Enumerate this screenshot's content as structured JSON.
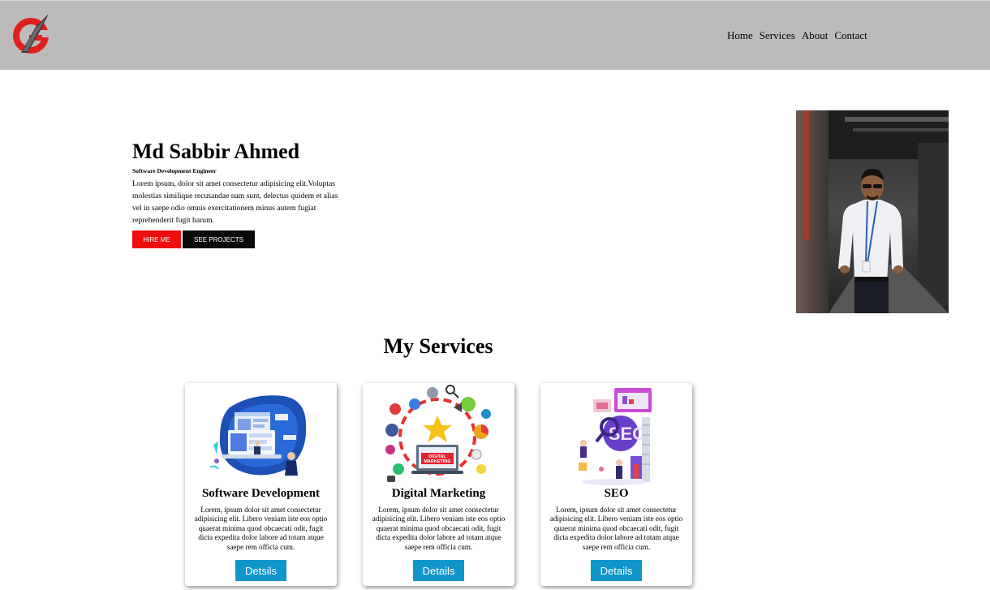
{
  "header": {
    "nav": [
      "Home",
      "Services",
      "About",
      "Contact"
    ]
  },
  "hero": {
    "name": "Md Sabbir Ahmed",
    "role": "Software Development Engineer",
    "description": "Lorem ipsum, dolor sit amet consectetur adipisicing elit.Voluptas molestias similique recusandae nam sunt, delectus quidem et alias vel in saepe odio omnis exercitationem minus autem fugiat reprehenderit fugit harum.",
    "hire_label": "HIRE ME",
    "projects_label": "SEE PROJECTS"
  },
  "services": {
    "title": "My Services",
    "cards": [
      {
        "title": "Software Development",
        "text": "Lorem, ipsum dolor sit amet consectetur adipisicing elit. Libero veniam iste eos optio quaerat minima quod obcaecati odit, fugit dicta expedita dolor labore ad totam atque saepe rem officia cum.",
        "button": "Detsils"
      },
      {
        "title": "Digital Marketing",
        "text": "Lorem, ipsum dolor sit amet consectetur adipisicing elit. Libero veniam iste eos optio quaerat minima quod obcaecati odit, fugit dicta expedita dolor labore ad totam atque saepe rem officia cum.",
        "button": "Details",
        "image_text": [
          "DIGITAL",
          "MARKETING"
        ]
      },
      {
        "title": "SEO",
        "text": "Lorem, ipsum dolor sit amet consectetur adipisicing elit. Libero veniam iste eos optio quaerat minima quod obcaecati odit, fugit dicta expedita dolor labore ad totam atque saepe rem officia cum.",
        "button": "Details",
        "image_text": "SEO"
      }
    ]
  },
  "colors": {
    "header_bg": "#bcbbbc",
    "hire_button": "#ee0c0c",
    "projects_button": "#0a0a0a",
    "details_button": "#1196cc",
    "logo_red": "#e0201e"
  }
}
